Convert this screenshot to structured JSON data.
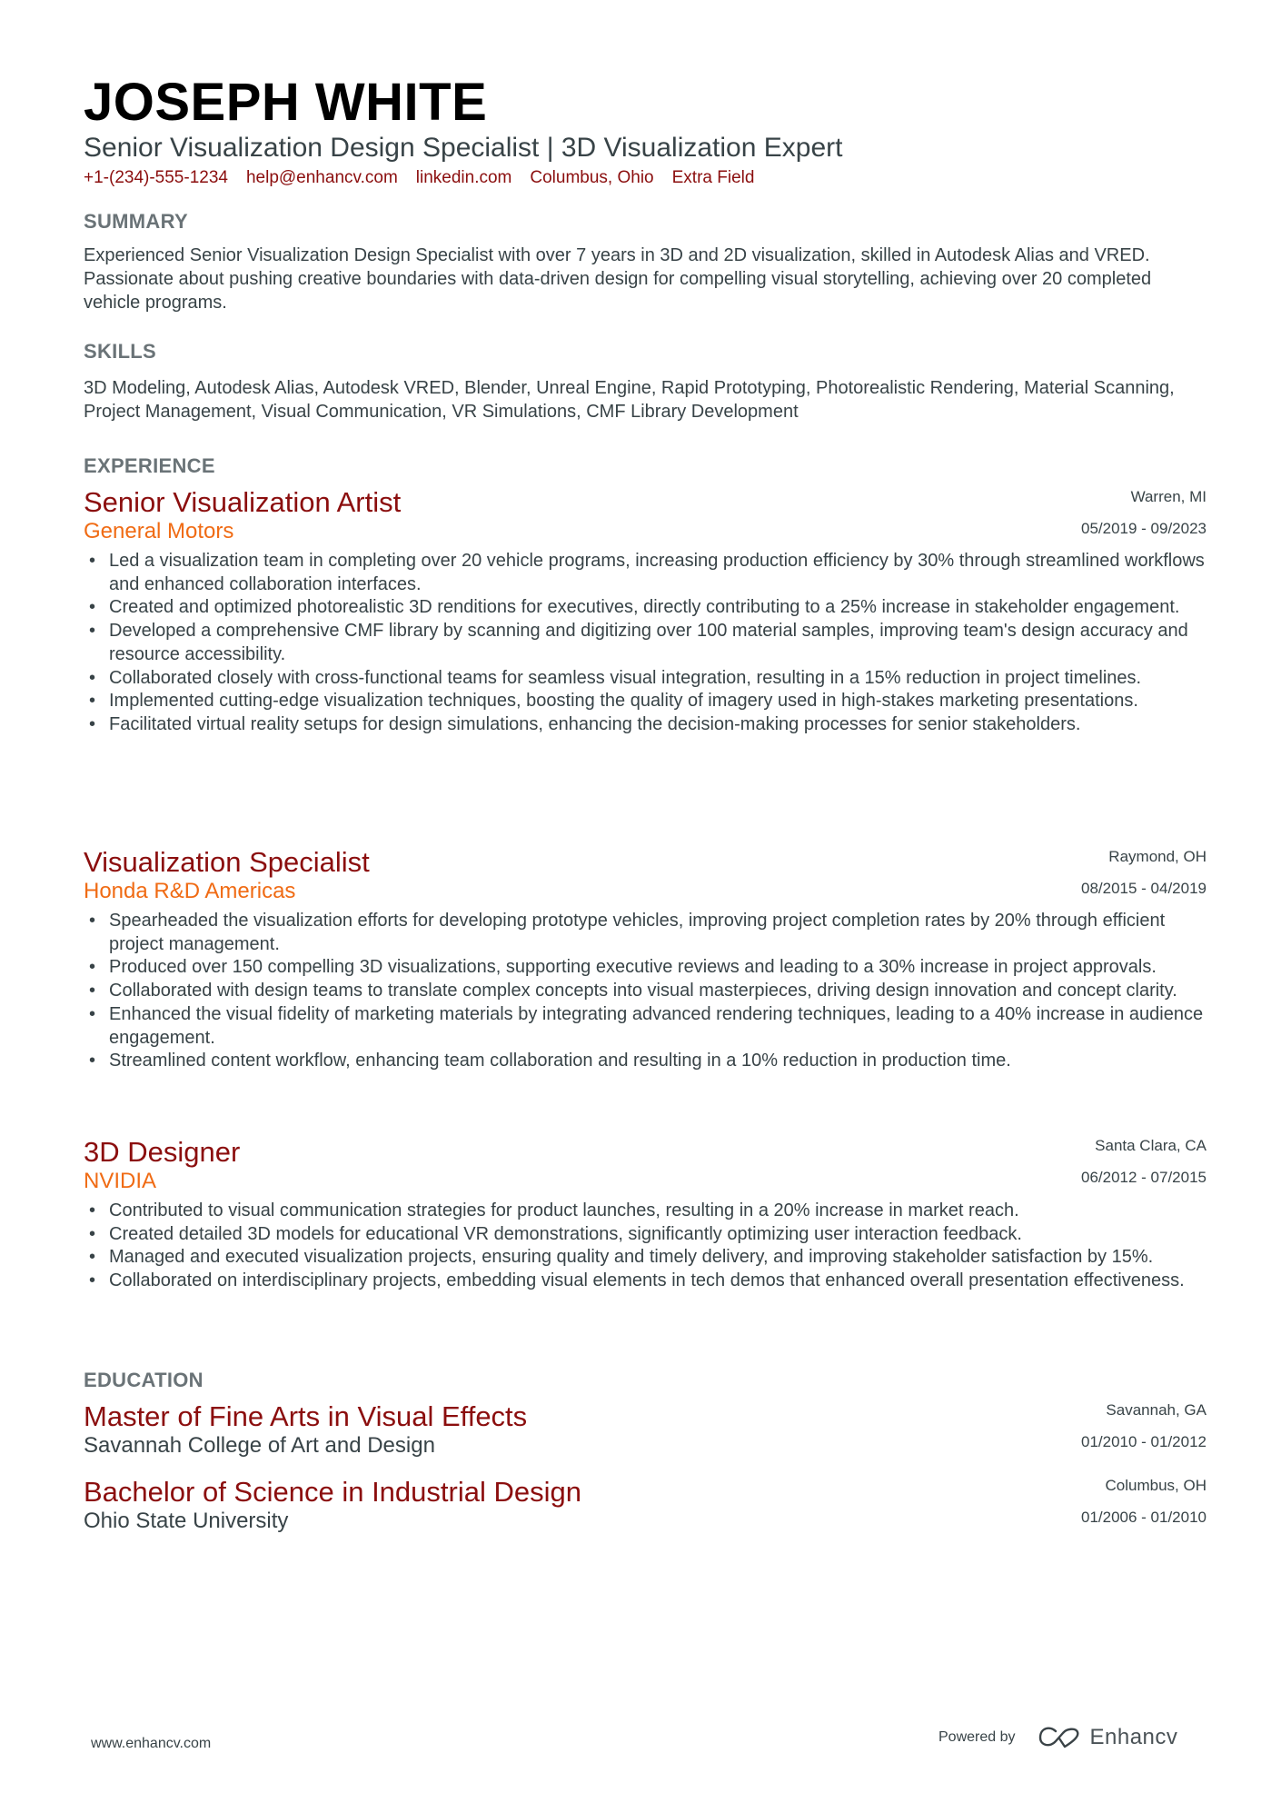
{
  "header": {
    "name": "JOSEPH WHITE",
    "headline": "Senior Visualization Design Specialist | 3D Visualization Expert",
    "contacts": [
      {
        "type": "phone",
        "value": "+1-(234)-555-1234"
      },
      {
        "type": "email",
        "value": "help@enhancv.com"
      },
      {
        "type": "linkedin",
        "value": "linkedin.com"
      },
      {
        "type": "location",
        "value": "Columbus, Ohio"
      },
      {
        "type": "extra",
        "value": "Extra Field"
      }
    ]
  },
  "summary": {
    "title": "SUMMARY",
    "text": "Experienced Senior Visualization Design Specialist with over 7 years in 3D and 2D visualization, skilled in Autodesk Alias and VRED. Passionate about pushing creative boundaries with data-driven design for compelling visual storytelling, achieving over 20 completed vehicle programs."
  },
  "skills": {
    "title": "SKILLS",
    "text": "3D Modeling, Autodesk Alias, Autodesk VRED, Blender, Unreal Engine, Rapid Prototyping, Photorealistic Rendering, Material Scanning, Project Management, Visual Communication, VR Simulations, CMF Library Development"
  },
  "experience": {
    "title": "EXPERIENCE",
    "jobs": [
      {
        "title": "Senior Visualization Artist",
        "company": "General Motors",
        "location": "Warren, MI",
        "dates": "05/2019 - 09/2023",
        "bullets": [
          "Led a visualization team in completing over 20 vehicle programs, increasing production efficiency by 30% through streamlined workflows and enhanced collaboration interfaces.",
          "Created and optimized photorealistic 3D renditions for executives, directly contributing to a 25% increase in stakeholder engagement.",
          "Developed a comprehensive CMF library by scanning and digitizing over 100 material samples, improving team's design accuracy and resource accessibility.",
          "Collaborated closely with cross-functional teams for seamless visual integration, resulting in a 15% reduction in project timelines.",
          "Implemented cutting-edge visualization techniques, boosting the quality of imagery used in high-stakes marketing presentations.",
          "Facilitated virtual reality setups for design simulations, enhancing the decision-making processes for senior stakeholders."
        ]
      },
      {
        "title": "Visualization Specialist",
        "company": "Honda R&D Americas",
        "location": "Raymond, OH",
        "dates": "08/2015 - 04/2019",
        "bullets": [
          "Spearheaded the visualization efforts for developing prototype vehicles, improving project completion rates by 20% through efficient project management.",
          "Produced over 150 compelling 3D visualizations, supporting executive reviews and leading to a 30% increase in project approvals.",
          "Collaborated with design teams to translate complex concepts into visual masterpieces, driving design innovation and concept clarity.",
          "Enhanced the visual fidelity of marketing materials by integrating advanced rendering techniques, leading to a 40% increase in audience engagement.",
          "Streamlined content workflow, enhancing team collaboration and resulting in a 10% reduction in production time."
        ]
      },
      {
        "title": "3D Designer",
        "company": "NVIDIA",
        "location": "Santa Clara, CA",
        "dates": "06/2012 - 07/2015",
        "bullets": [
          "Contributed to visual communication strategies for product launches, resulting in a 20% increase in market reach.",
          "Created detailed 3D models for educational VR demonstrations, significantly optimizing user interaction feedback.",
          "Managed and executed visualization projects, ensuring quality and timely delivery, and improving stakeholder satisfaction by 15%.",
          "Collaborated on interdisciplinary projects, embedding visual elements in tech demos that enhanced overall presentation effectiveness."
        ]
      }
    ]
  },
  "education": {
    "title": "EDUCATION",
    "items": [
      {
        "degree": "Master of Fine Arts in Visual Effects",
        "school": "Savannah College of Art and Design",
        "location": "Savannah, GA",
        "dates": "01/2010 - 01/2012"
      },
      {
        "degree": "Bachelor of Science in Industrial Design",
        "school": "Ohio State University",
        "location": "Columbus, OH",
        "dates": "01/2006 - 01/2010"
      }
    ]
  },
  "footer": {
    "website": "www.enhancv.com",
    "powered_by": "Powered by",
    "brand": "Enhancv",
    "brand_icon": "enhancv-logo-icon"
  },
  "colors": {
    "name": "#000000",
    "accent_title": "#8b0e0e",
    "accent_company": "#f06b14",
    "section_heading": "#6a7377",
    "body_text": "#384347"
  }
}
